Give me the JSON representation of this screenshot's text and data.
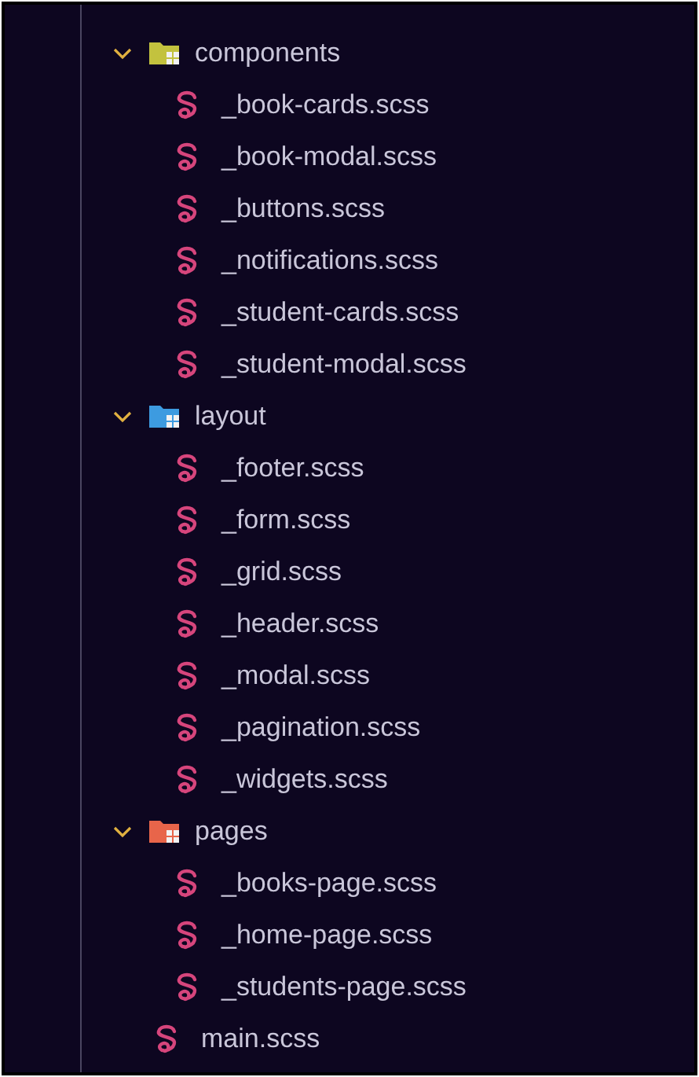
{
  "tree": [
    {
      "kind": "folder",
      "label": "components",
      "expanded": true,
      "color": "#c3c23e",
      "children": [
        {
          "kind": "file",
          "label": "_book-cards.scss"
        },
        {
          "kind": "file",
          "label": "_book-modal.scss"
        },
        {
          "kind": "file",
          "label": "_buttons.scss"
        },
        {
          "kind": "file",
          "label": "_notifications.scss"
        },
        {
          "kind": "file",
          "label": "_student-cards.scss"
        },
        {
          "kind": "file",
          "label": "_student-modal.scss"
        }
      ]
    },
    {
      "kind": "folder",
      "label": "layout",
      "expanded": true,
      "color": "#3d9be0",
      "children": [
        {
          "kind": "file",
          "label": "_footer.scss"
        },
        {
          "kind": "file",
          "label": "_form.scss"
        },
        {
          "kind": "file",
          "label": "_grid.scss"
        },
        {
          "kind": "file",
          "label": "_header.scss"
        },
        {
          "kind": "file",
          "label": "_modal.scss"
        },
        {
          "kind": "file",
          "label": "_pagination.scss"
        },
        {
          "kind": "file",
          "label": "_widgets.scss"
        }
      ]
    },
    {
      "kind": "folder",
      "label": "pages",
      "expanded": true,
      "color": "#e8654a",
      "children": [
        {
          "kind": "file",
          "label": "_books-page.scss"
        },
        {
          "kind": "file",
          "label": "_home-page.scss"
        },
        {
          "kind": "file",
          "label": "_students-page.scss"
        }
      ]
    },
    {
      "kind": "file",
      "label": "main.scss"
    }
  ]
}
